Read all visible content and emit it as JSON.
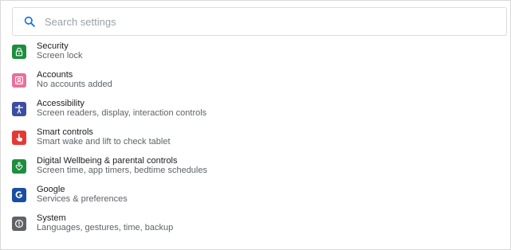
{
  "search": {
    "placeholder": "Search settings",
    "icon": "search-icon",
    "icon_color": "#1a73e8"
  },
  "settings": {
    "items": [
      {
        "id": "security",
        "title": "Security",
        "subtitle": "Screen lock",
        "icon": "lock-icon",
        "color": "#1e8e3e"
      },
      {
        "id": "accounts",
        "title": "Accounts",
        "subtitle": "No accounts added",
        "icon": "account-icon",
        "color": "#e8709c"
      },
      {
        "id": "accessibility",
        "title": "Accessibility",
        "subtitle": "Screen readers, display, interaction controls",
        "icon": "accessibility-icon",
        "color": "#3c4f9e"
      },
      {
        "id": "smart-controls",
        "title": "Smart controls",
        "subtitle": "Smart wake and lift to check tablet",
        "icon": "hand-icon",
        "color": "#e53935"
      },
      {
        "id": "digital-wellbeing",
        "title": "Digital Wellbeing & parental controls",
        "subtitle": "Screen time, app timers, bedtime schedules",
        "icon": "wellbeing-icon",
        "color": "#1e8e3e"
      },
      {
        "id": "google",
        "title": "Google",
        "subtitle": "Services & preferences",
        "icon": "google-icon",
        "color": "#1a4fa0"
      },
      {
        "id": "system",
        "title": "System",
        "subtitle": "Languages, gestures, time, backup",
        "icon": "info-icon",
        "color": "#5f6368"
      }
    ]
  }
}
